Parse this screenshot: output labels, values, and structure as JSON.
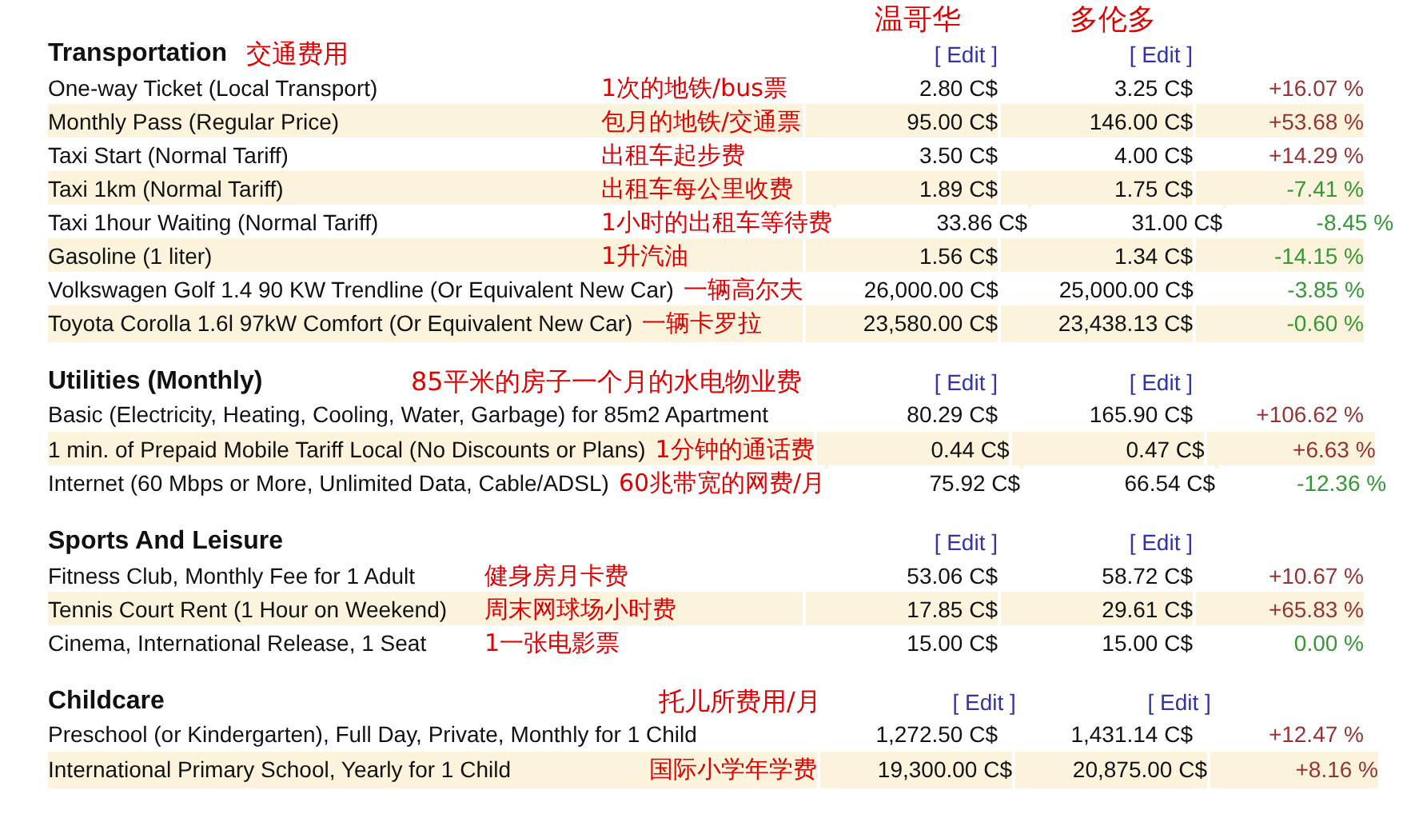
{
  "city_headers": [
    {
      "label": "温哥华"
    },
    {
      "label": "多伦多"
    }
  ],
  "sections": [
    {
      "title": "Transportation",
      "note": "交通费用",
      "edit_links": [
        "[ Edit ]",
        "[ Edit ]"
      ],
      "rows": [
        {
          "item": "One-way Ticket (Local Transport)",
          "note": "1次的地铁/bus票",
          "city_1": "2.80 C$",
          "city_2": "3.25 C$",
          "difference": "+16.07 %",
          "color": "#993333"
        },
        {
          "item": "Monthly Pass (Regular Price)",
          "note": "包月的地铁/交通票",
          "city_1": "95.00 C$",
          "city_2": "146.00 C$",
          "difference": "+53.68 %",
          "color": "#993333"
        },
        {
          "item": "Taxi Start (Normal Tariff)",
          "note": "出租车起步费",
          "city_1": "3.50 C$",
          "city_2": "4.00 C$",
          "difference": "+14.29 %",
          "color": "#993333"
        },
        {
          "item": "Taxi 1km (Normal Tariff)",
          "note": "出租车每公里收费",
          "city_1": "1.89 C$",
          "city_2": "1.75 C$",
          "difference": "-7.41 %",
          "color": "#339933"
        },
        {
          "item": "Taxi 1hour Waiting (Normal Tariff)",
          "note": "1小时的出租车等待费",
          "city_1": "33.86 C$",
          "city_2": "31.00 C$",
          "difference": "-8.45 %",
          "color": "#339933"
        },
        {
          "item": "Gasoline (1 liter)",
          "note": "1升汽油",
          "city_1": "1.56 C$",
          "city_2": "1.34 C$",
          "difference": "-14.15 %",
          "color": "#339933"
        },
        {
          "item": "Volkswagen Golf 1.4 90 KW Trendline (Or Equivalent New Car)",
          "note": "一辆高尔夫",
          "city_1": "26,000.00 C$",
          "city_2": "25,000.00 C$",
          "difference": "-3.85 %",
          "color": "#339933"
        },
        {
          "item": "Toyota Corolla 1.6l 97kW Comfort (Or Equivalent New Car)",
          "note": "一辆卡罗拉",
          "city_1": "23,580.00 C$",
          "city_2": "23,438.13 C$",
          "difference": "-0.60 %",
          "color": "#339933"
        }
      ]
    },
    {
      "title": "Utilities (Monthly)",
      "note": "85平米的房子一个月的水电物业费",
      "edit_links": [
        "[ Edit ]",
        "[ Edit ]"
      ],
      "rows": [
        {
          "item": "Basic (Electricity, Heating, Cooling, Water, Garbage) for 85m2 Apartment",
          "city_1": "80.29 C$",
          "city_2": "165.90 C$",
          "difference": "+106.62 %",
          "color": "#993333"
        },
        {
          "item": "1 min. of Prepaid Mobile Tariff Local (No Discounts or Plans)",
          "note": "1分钟的通话费",
          "city_1": "0.44 C$",
          "city_2": "0.47 C$",
          "difference": "+6.63 %",
          "color": "#993333"
        },
        {
          "item": "Internet (60 Mbps or More, Unlimited Data, Cable/ADSL)",
          "note": "60兆带宽的网费/月",
          "city_1": "75.92 C$",
          "city_2": "66.54 C$",
          "difference": "-12.36 %",
          "color": "#339933"
        }
      ]
    },
    {
      "title": "Sports And Leisure",
      "edit_links": [
        "[ Edit ]",
        "[ Edit ]"
      ],
      "rows": [
        {
          "item": "Fitness Club, Monthly Fee for 1 Adult",
          "note": "健身房月卡费",
          "city_1": "53.06 C$",
          "city_2": "58.72 C$",
          "difference": "+10.67 %",
          "color": "#993333"
        },
        {
          "item": "Tennis Court Rent (1 Hour on Weekend)",
          "note": "周末网球场小时费",
          "city_1": "17.85 C$",
          "city_2": "29.61 C$",
          "difference": "+65.83 %",
          "color": "#993333"
        },
        {
          "item": "Cinema, International Release, 1 Seat",
          "note": "1一张电影票",
          "city_1": "15.00 C$",
          "city_2": "15.00 C$",
          "difference": "0.00 %",
          "color": "#339933"
        }
      ]
    },
    {
      "title": "Childcare",
      "note": "托儿所费用/月",
      "edit_links": [
        "[ Edit ]",
        "[ Edit ]"
      ],
      "rows": [
        {
          "item": "Preschool (or Kindergarten), Full Day, Private, Monthly for 1 Child",
          "city_1": "1,272.50 C$",
          "city_2": "1,431.14 C$",
          "difference": "+12.47 %",
          "color": "#993333"
        },
        {
          "item": "International Primary School, Yearly for 1 Child",
          "note": "国际小学年学费",
          "city_1": "19,300.00 C$",
          "city_2": "20,875.00 C$",
          "difference": "+8.16 %",
          "color": "#993333"
        }
      ]
    }
  ]
}
